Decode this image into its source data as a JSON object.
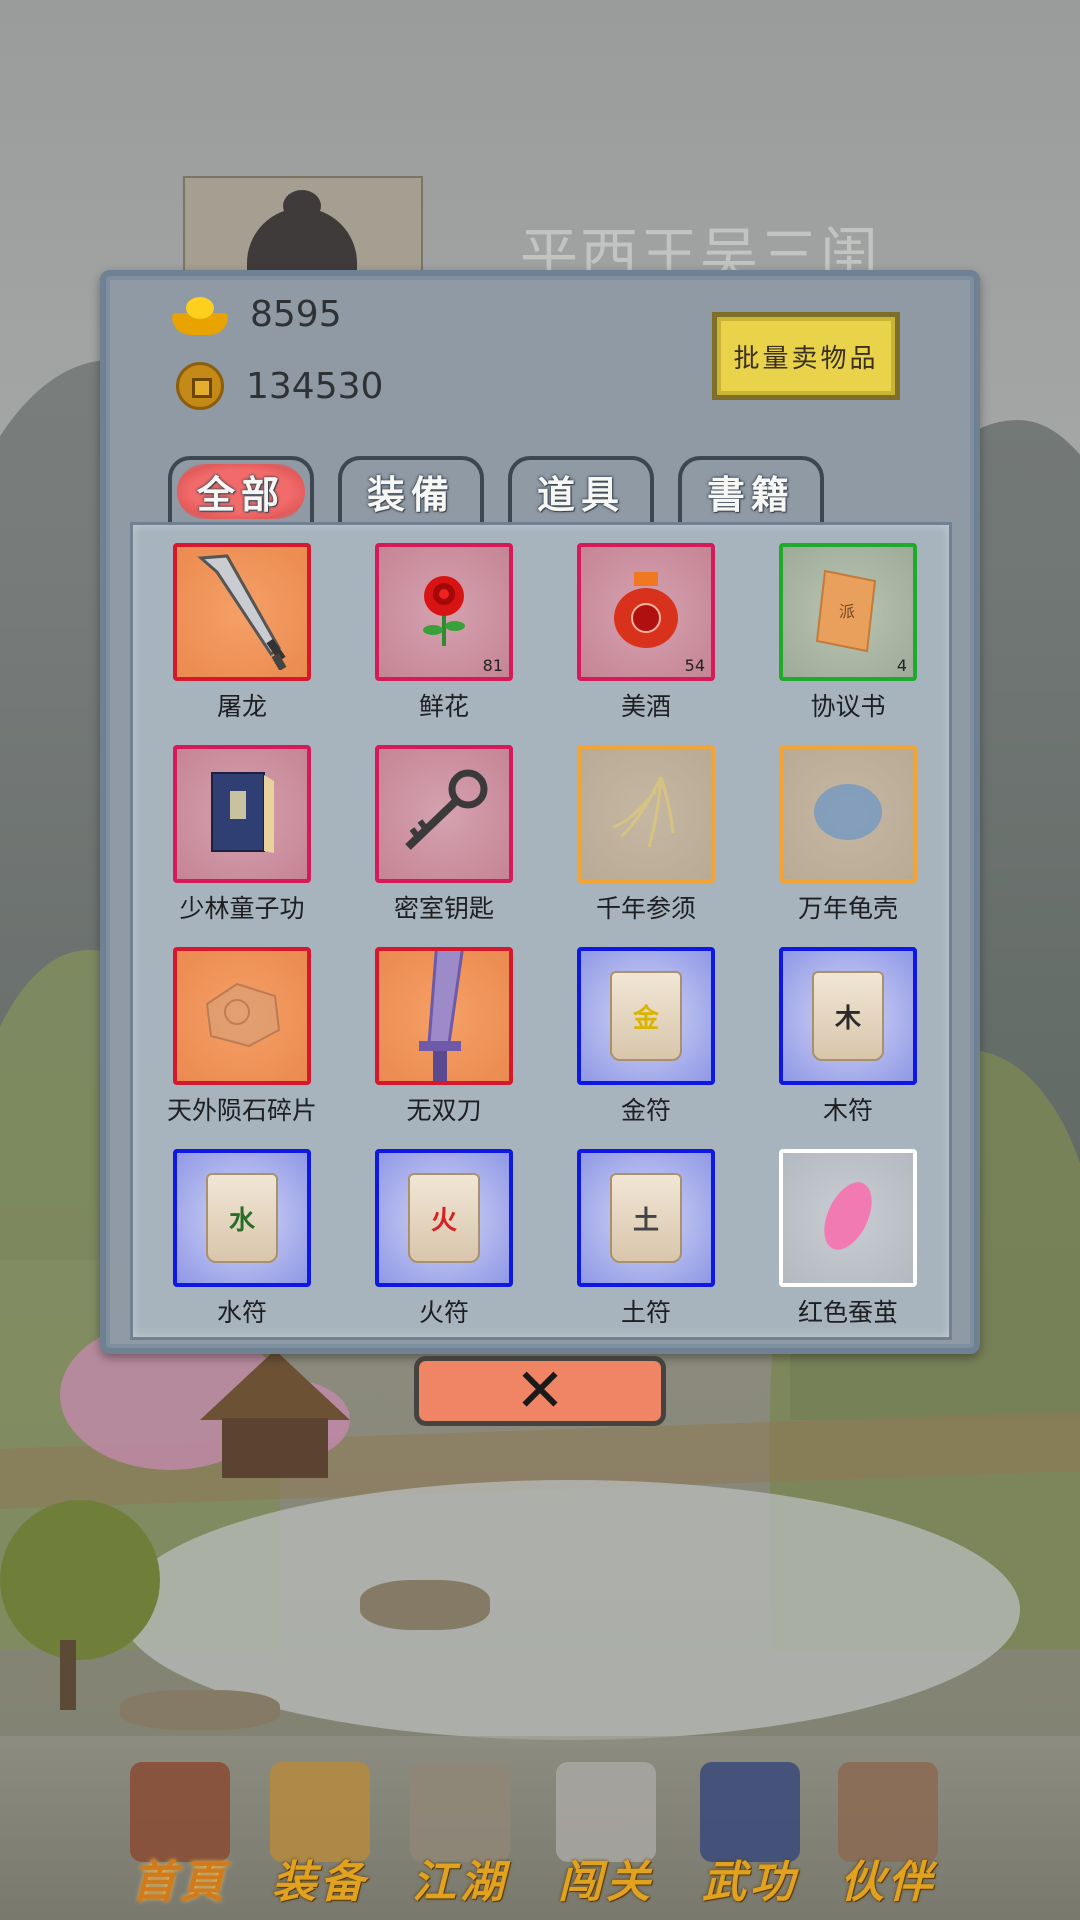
{
  "character": {
    "name": "平西王吴三闺"
  },
  "currency": {
    "ingots": "8595",
    "coins": "134530"
  },
  "sell_button": "批量卖物品",
  "tabs": [
    {
      "label": "全部",
      "active": true
    },
    {
      "label": "装備",
      "active": false
    },
    {
      "label": "道具",
      "active": false
    },
    {
      "label": "書籍",
      "active": false
    }
  ],
  "items": [
    {
      "name": "屠龙",
      "count": "",
      "rarity": "orange",
      "icon": "broadsword-icon"
    },
    {
      "name": "鲜花",
      "count": "81",
      "rarity": "pink",
      "icon": "rose-icon"
    },
    {
      "name": "美酒",
      "count": "54",
      "rarity": "pink",
      "icon": "wine-jar-icon"
    },
    {
      "name": "协议书",
      "count": "4",
      "rarity": "green",
      "icon": "contract-scroll-icon"
    },
    {
      "name": "少林童子功",
      "count": "",
      "rarity": "pink",
      "icon": "book-icon"
    },
    {
      "name": "密室钥匙",
      "count": "",
      "rarity": "pink",
      "icon": "key-icon"
    },
    {
      "name": "千年参须",
      "count": "",
      "rarity": "gold",
      "icon": "ginseng-icon"
    },
    {
      "name": "万年龟壳",
      "count": "",
      "rarity": "gold",
      "icon": "turtle-shell-icon"
    },
    {
      "name": "天外陨石碎片",
      "count": "",
      "rarity": "orange",
      "icon": "meteorite-icon"
    },
    {
      "name": "无双刀",
      "count": "",
      "rarity": "orange",
      "icon": "blade-icon"
    },
    {
      "name": "金符",
      "count": "",
      "rarity": "blue",
      "icon": "talisman-icon",
      "glyph": "金",
      "glyph_color": "#d9b400"
    },
    {
      "name": "木符",
      "count": "",
      "rarity": "blue",
      "icon": "talisman-icon",
      "glyph": "木",
      "glyph_color": "#2b2b2b"
    },
    {
      "name": "水符",
      "count": "",
      "rarity": "blue",
      "icon": "talisman-icon",
      "glyph": "水",
      "glyph_color": "#2a6d2a"
    },
    {
      "name": "火符",
      "count": "",
      "rarity": "blue",
      "icon": "talisman-icon",
      "glyph": "火",
      "glyph_color": "#d82020"
    },
    {
      "name": "土符",
      "count": "",
      "rarity": "blue",
      "icon": "talisman-icon",
      "glyph": "土",
      "glyph_color": "#444444"
    },
    {
      "name": "红色蚕茧",
      "count": "",
      "rarity": "white",
      "icon": "cocoon-icon"
    }
  ],
  "close_button": "✕",
  "bottom_nav": [
    {
      "label": "首頁",
      "icon": "house-icon",
      "active": true
    },
    {
      "label": "装备",
      "icon": "armor-icon",
      "active": false
    },
    {
      "label": "江湖",
      "icon": "scroll-icon",
      "active": false
    },
    {
      "label": "闯关",
      "icon": "crossed-swords-icon",
      "active": false
    },
    {
      "label": "武功",
      "icon": "manual-book-icon",
      "active": false
    },
    {
      "label": "伙伴",
      "icon": "partners-icon",
      "active": false
    }
  ]
}
